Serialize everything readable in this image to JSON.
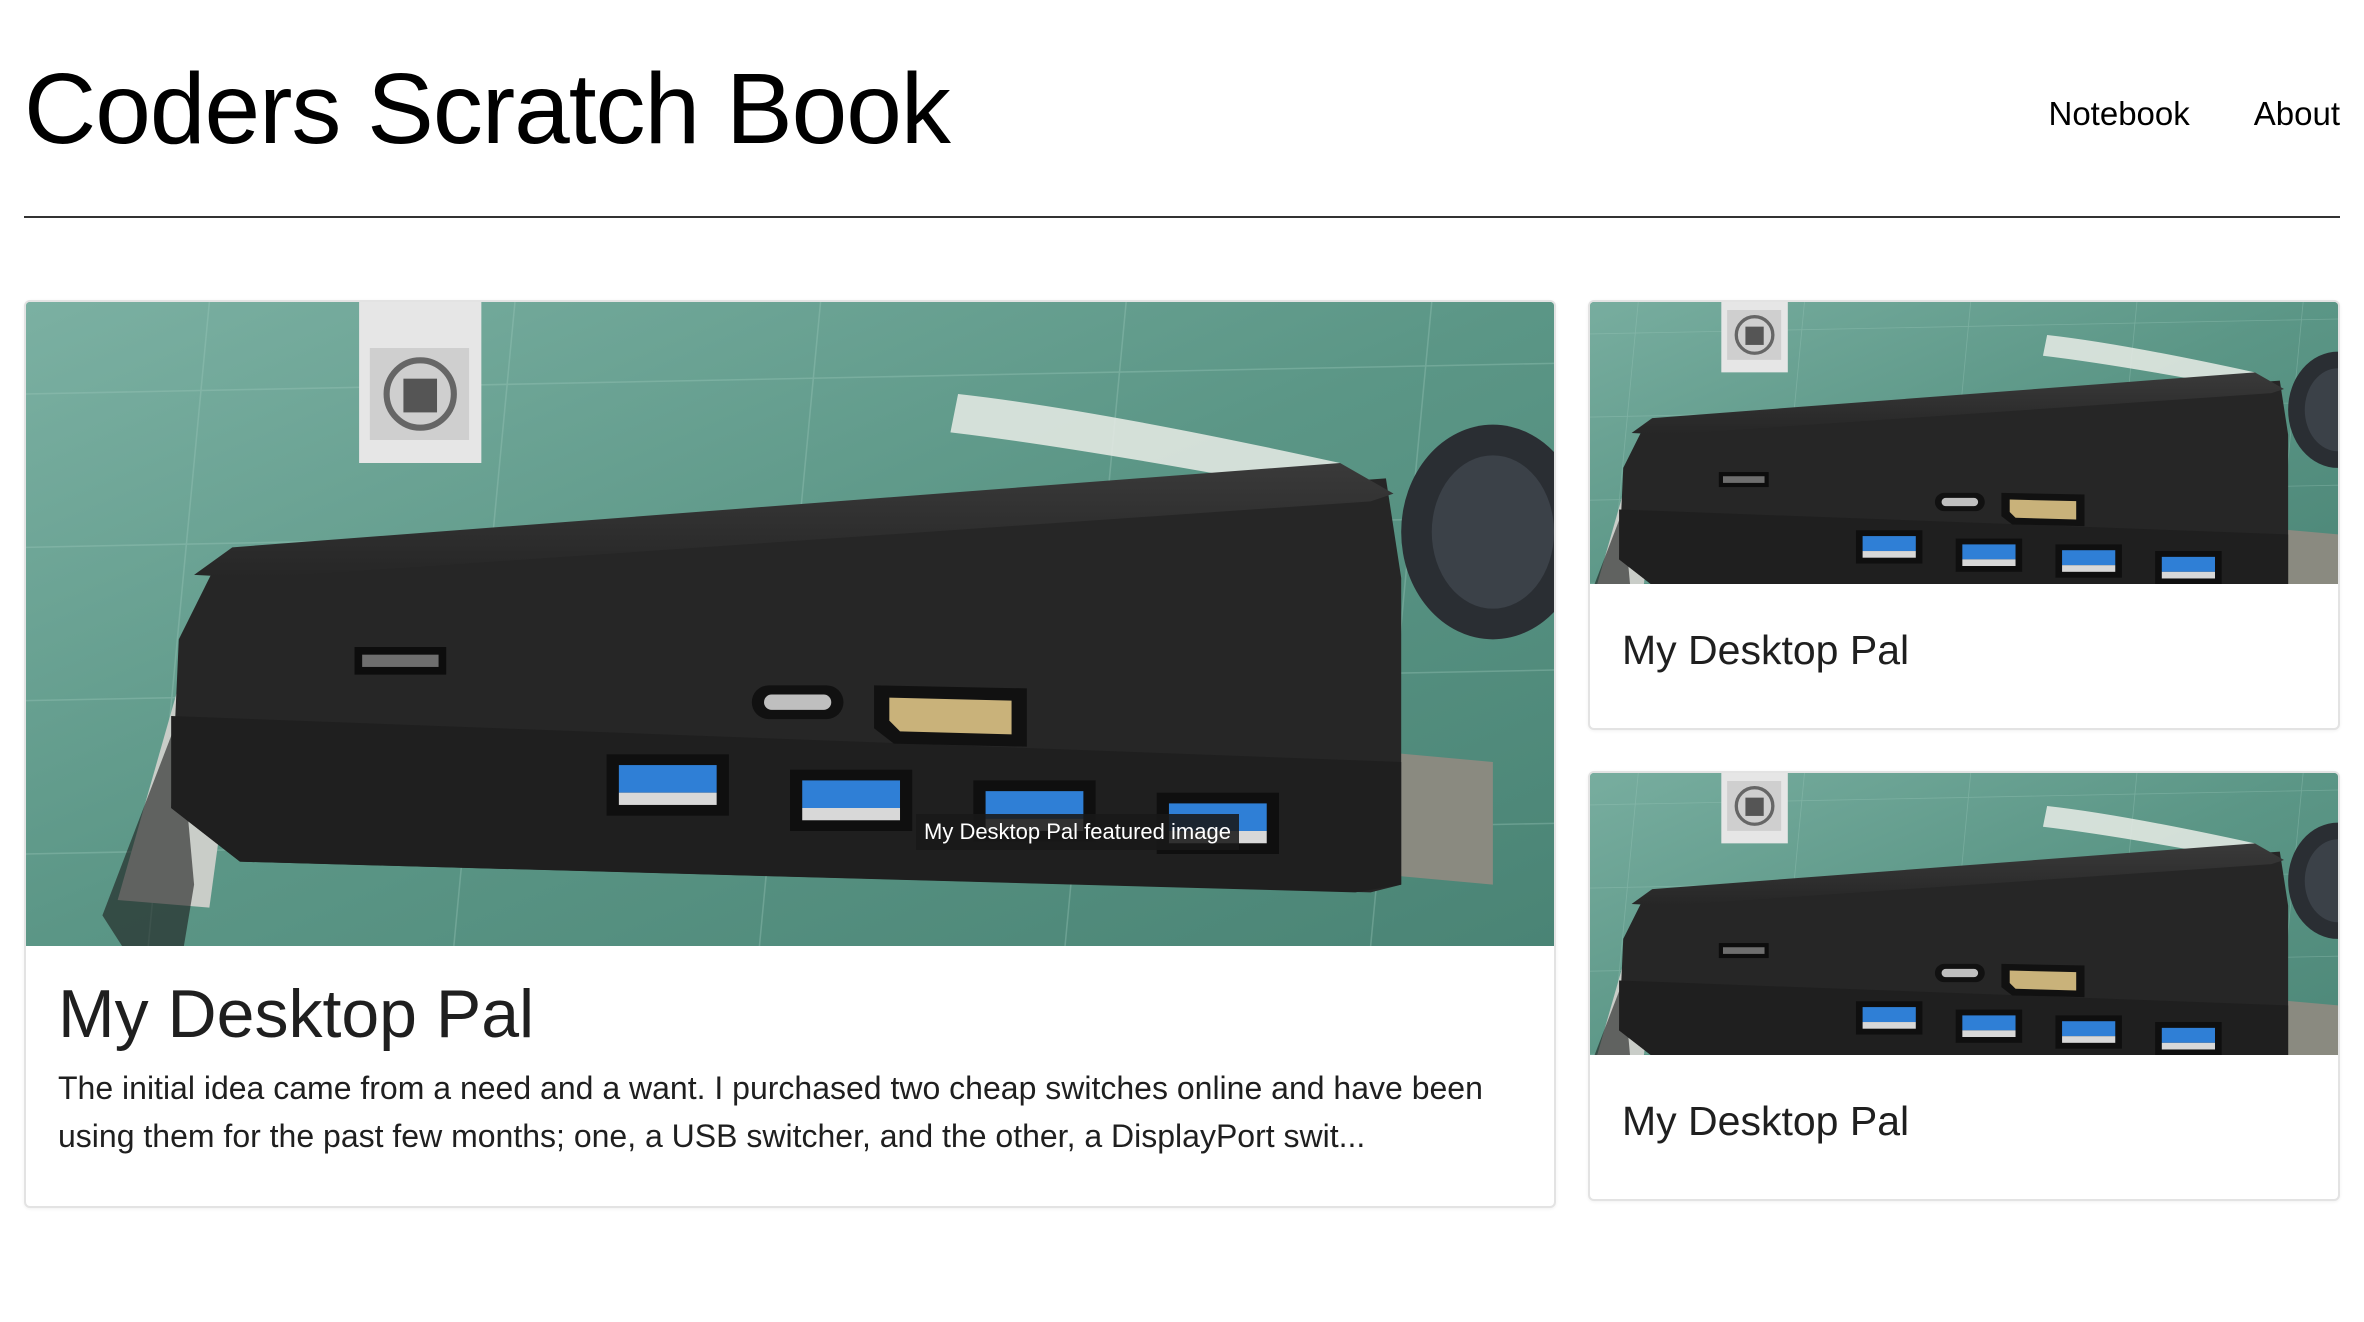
{
  "site": {
    "title": "Coders Scratch Book"
  },
  "nav": {
    "items": [
      "Notebook",
      "About"
    ]
  },
  "featured": {
    "title": "My Desktop Pal",
    "image_tooltip": "My Desktop Pal featured image",
    "excerpt": "The initial idea came from a need and a want. I purchased two cheap switches online and have been using them for the past few months; one, a USB switcher, and the other, a DisplayPort swit..."
  },
  "side_posts": [
    {
      "title": "My Desktop Pal"
    },
    {
      "title": "My Desktop Pal"
    }
  ],
  "colors": {
    "text": "#000000",
    "mat_green": "#5a9585",
    "device": "#2b2b2b",
    "usb_blue": "#2f7fd6"
  }
}
